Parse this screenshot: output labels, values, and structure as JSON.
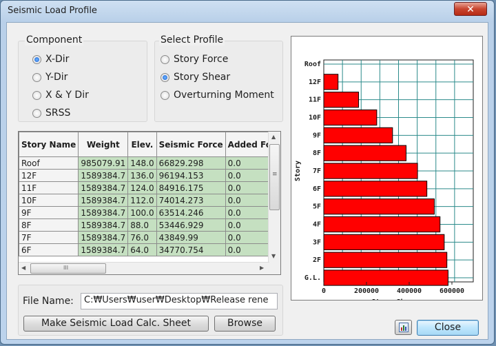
{
  "window": {
    "title": "Seismic Load Profile",
    "close_glyph": "✕"
  },
  "component": {
    "legend": "Component",
    "options": [
      "X-Dir",
      "Y-Dir",
      "X & Y Dir",
      "SRSS"
    ],
    "selected_index": 0
  },
  "profile": {
    "legend": "Select Profile",
    "options": [
      "Story Force",
      "Story Shear",
      "Overturning Moment"
    ],
    "selected_index": 1
  },
  "table": {
    "headers": [
      "Story Name",
      "Weight",
      "Elev.",
      "Seismic Force",
      "Added Force"
    ],
    "rows": [
      [
        "Roof",
        "985079.91",
        "148.0",
        "66829.298",
        "0.0"
      ],
      [
        "12F",
        "1589384.7",
        "136.0",
        "96194.153",
        "0.0"
      ],
      [
        "11F",
        "1589384.7",
        "124.0",
        "84916.175",
        "0.0"
      ],
      [
        "10F",
        "1589384.7",
        "112.0",
        "74014.273",
        "0.0"
      ],
      [
        "9F",
        "1589384.7",
        "100.0",
        "63514.246",
        "0.0"
      ],
      [
        "8F",
        "1589384.7",
        "88.0",
        "53446.929",
        "0.0"
      ],
      [
        "7F",
        "1589384.7",
        "76.0",
        "43849.99",
        "0.0"
      ],
      [
        "6F",
        "1589384.7",
        "64.0",
        "34770.754",
        "0.0"
      ]
    ],
    "scroll_glyphs": {
      "up": "▲",
      "down": "▼",
      "left": "◀",
      "right": "▶",
      "grip_v": "≡",
      "grip_h": "III"
    }
  },
  "file": {
    "label": "File Name:",
    "value": "C:₩Users₩user₩Desktop₩Release rene"
  },
  "buttons": {
    "make_sheet": "Make Seismic Load Calc. Sheet",
    "browse": "Browse",
    "close": "Close"
  },
  "chart_data": {
    "type": "bar",
    "orientation": "horizontal",
    "xlabel": "Story Shear",
    "ylabel": "Story",
    "categories": [
      "Roof",
      "12F",
      "11F",
      "10F",
      "9F",
      "8F",
      "7F",
      "6F",
      "5F",
      "4F",
      "3F",
      "2F",
      "G.L."
    ],
    "values": [
      0,
      66829,
      163023,
      247940,
      321954,
      385468,
      438915,
      482765,
      517536,
      544300,
      564000,
      576500,
      582000
    ],
    "xticks": [
      0,
      200000,
      400000,
      600000
    ],
    "xtick_labels": [
      "0",
      "200000",
      "400000",
      "600000"
    ],
    "xlim": [
      0,
      700000
    ],
    "grid": true,
    "bar_color": "#ff0000",
    "bar_edge": "#000000"
  }
}
